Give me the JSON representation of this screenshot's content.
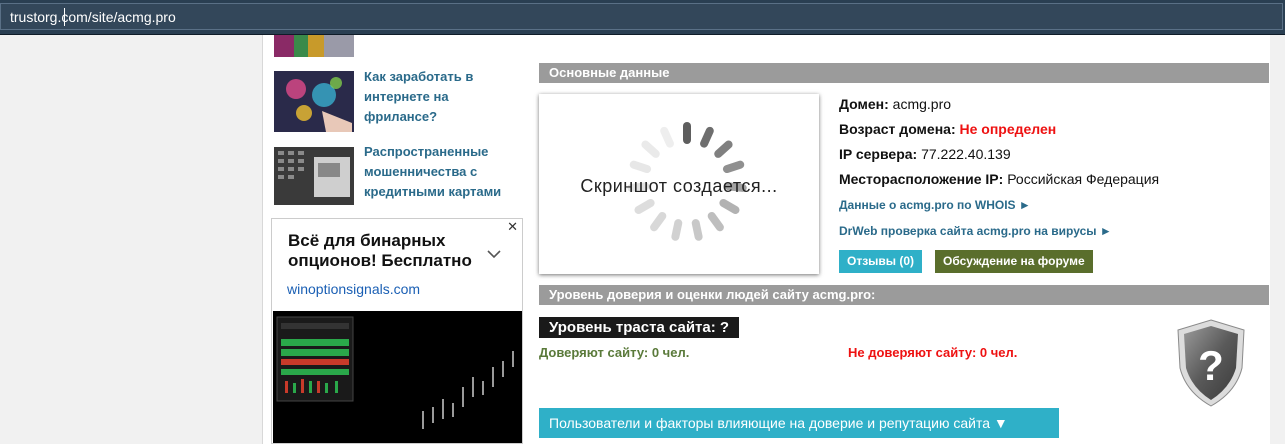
{
  "browser": {
    "url": "trustorg.com/site/acmg.pro"
  },
  "sidebar": {
    "news": [
      {
        "title": "Как заработать в интернете на фрилансе?",
        "lines": [
          "Как заработать в",
          "интернете на",
          "фрилансе?"
        ]
      },
      {
        "title": "Распространенные мошенничества с кредитными картами",
        "lines": [
          "Распространенные",
          "мошенничества с",
          "кредитными картами"
        ]
      }
    ],
    "ad": {
      "title_line1": "Всё для бинарных",
      "title_line2": "опционов! Бесплатно",
      "domain": "winoptionsignals.com",
      "close": "✕"
    }
  },
  "main": {
    "basic_header": "Основные данные",
    "screenshot_text": "Скриншот создается...",
    "domain_label": "Домен:",
    "domain_value": "acmg.pro",
    "age_label": "Возраст домена:",
    "age_value": "Не определен",
    "ip_label": "IP сервера:",
    "ip_value": "77.222.40.139",
    "location_label": "Месторасположение IP:",
    "location_value": "Российская Федерация",
    "whois_link": "Данные о acmg.pro по WHOIS ►",
    "drweb_link": "DrWeb проверка сайта acmg.pro на вирусы ►",
    "reviews_button": "Отзывы (0)",
    "forum_button": "Обсуждение на форуме",
    "trust_header": "Уровень доверия и оценки людей сайту acmg.pro:",
    "trust_level": "Уровень траста сайта: ?",
    "trust_yes": "Доверяют сайту: 0 чел.",
    "trust_no": "Не доверяют сайту: 0 чел.",
    "shield_symbol": "?",
    "users_factors_button": "Пользователи и факторы влияющие на доверие и репутацию сайта ▼"
  },
  "colors": {
    "accent_teal": "#2fb0c8",
    "forum_green": "#5a6e2c",
    "section_gray": "#9b9b9b",
    "link_blue": "#2a6a8a",
    "alert_red": "#ee1111"
  }
}
